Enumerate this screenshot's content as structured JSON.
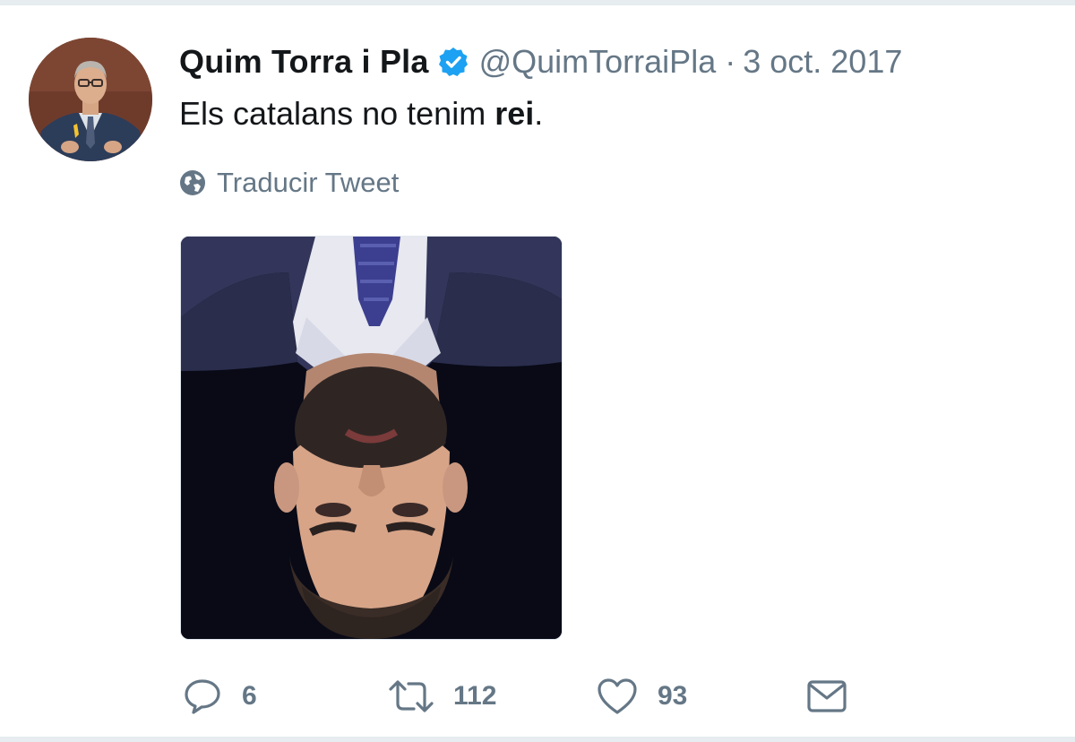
{
  "tweet": {
    "display_name": "Quim Torra i Pla",
    "handle": "@QuimTorraiPla",
    "separator": "·",
    "date": "3 oct. 2017",
    "text_prefix": "Els catalans no tenim ",
    "text_bold": "rei",
    "text_suffix": ".",
    "translate_label": "Traducir Tweet"
  },
  "actions": {
    "replies": "6",
    "retweets": "112",
    "likes": "93"
  },
  "icons": {
    "verified": "verified-badge-icon",
    "globe": "globe-icon",
    "reply": "reply-icon",
    "retweet": "retweet-icon",
    "like": "heart-icon",
    "dm": "envelope-icon"
  },
  "colors": {
    "text": "#14171a",
    "secondary": "#657786",
    "verified": "#1da1f2",
    "divider": "#e6ecf0"
  }
}
